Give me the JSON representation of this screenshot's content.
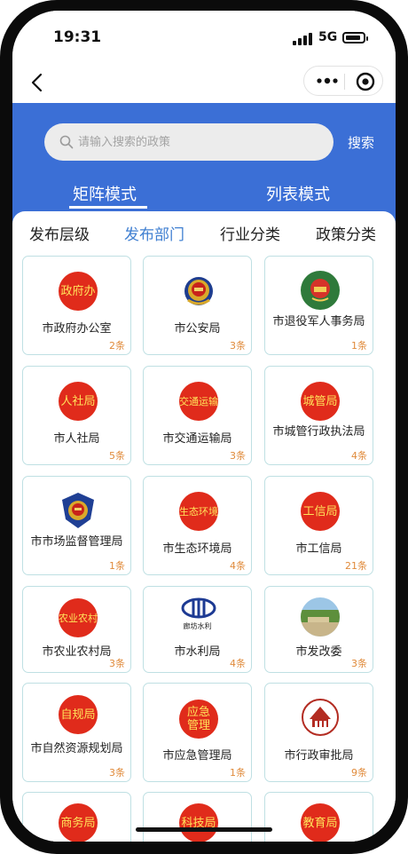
{
  "status": {
    "time": "19:31",
    "network": "5G"
  },
  "search": {
    "placeholder": "请输入搜索的政策",
    "button_label": "搜索"
  },
  "modes": [
    "矩阵模式",
    "列表模式"
  ],
  "tabs": [
    "发布层级",
    "发布部门",
    "行业分类",
    "政策分类"
  ],
  "colors": {
    "header_blue": "#3b6fd6",
    "active_tab": "#3f7fd1",
    "badge_red": "#e02b1b",
    "badge_text": "#ffe35a",
    "count_orange": "#e08a3a",
    "card_border": "#bfe0e3"
  },
  "departments": [
    {
      "name": "市政府办公室",
      "count": "2条",
      "badge": "政府办",
      "icon": "badge"
    },
    {
      "name": "市公安局",
      "count": "3条",
      "icon": "police-emblem-icon"
    },
    {
      "name": "市退役军人事务局",
      "count": "1条",
      "icon": "national-emblem-icon"
    },
    {
      "name": "市人社局",
      "count": "5条",
      "badge": "人社局",
      "icon": "badge"
    },
    {
      "name": "市交通运输局",
      "count": "3条",
      "badge": "交通运输",
      "icon": "badge"
    },
    {
      "name": "市城管行政执法局",
      "count": "4条",
      "badge": "城管局",
      "icon": "badge"
    },
    {
      "name": "市市场监督管理局",
      "count": "1条",
      "icon": "market-supervision-emblem-icon"
    },
    {
      "name": "市生态环境局",
      "count": "4条",
      "badge": "生态环境",
      "icon": "badge"
    },
    {
      "name": "市工信局",
      "count": "21条",
      "badge": "工信局",
      "icon": "badge"
    },
    {
      "name": "市农业农村局",
      "count": "3条",
      "badge": "农业农村",
      "icon": "badge"
    },
    {
      "name": "市水利局",
      "count": "4条",
      "icon": "water-resources-logo-icon",
      "logo_caption": "廊坊水利"
    },
    {
      "name": "市发改委",
      "count": "3条",
      "icon": "landscape-photo-icon"
    },
    {
      "name": "市自然资源规划局",
      "count": "3条",
      "badge": "自规局",
      "icon": "badge"
    },
    {
      "name": "市应急管理局",
      "count": "1条",
      "badge": "应急管理",
      "icon": "badge"
    },
    {
      "name": "市行政审批局",
      "count": "9条",
      "icon": "approval-bureau-seal-icon"
    },
    {
      "name": "",
      "count": "",
      "badge": "商务局",
      "icon": "badge"
    },
    {
      "name": "",
      "count": "",
      "badge": "科技局",
      "icon": "badge"
    },
    {
      "name": "",
      "count": "",
      "badge": "教育局",
      "icon": "badge"
    }
  ]
}
